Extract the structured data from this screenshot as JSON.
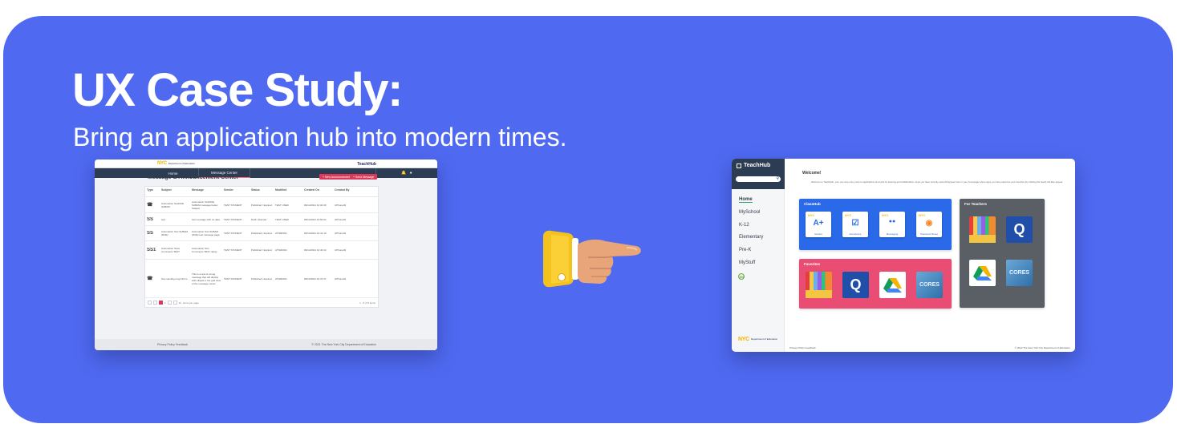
{
  "banner": {
    "title": "UX Case Study:",
    "subtitle": "Bring an application hub into modern times.",
    "background_color": "#4f69f0"
  },
  "old_ui": {
    "nyc_logo": "NYC",
    "nyc_logo_sub": "Department of Education",
    "brand": "TeachHub",
    "nav": [
      "Home",
      "Message Center"
    ],
    "nav_icons": [
      "bell-icon",
      "user-icon"
    ],
    "heading": "Message & Announcement Center",
    "buttons": [
      "+ New Announcement",
      "+ Send Message"
    ],
    "columns": [
      "Type",
      "Subject",
      "Message",
      "Sender",
      "Status",
      "Modified",
      "Created On",
      "Created By"
    ],
    "rows": [
      {
        "type": "☎",
        "subject": "Automation TestDOE SUBAM",
        "message": "Automation TestDOE SUBAM message below Subject",
        "sender": "TEST STUDENT",
        "status": "Published / Expired",
        "modified": "TEST USER",
        "created": "09/14/2021 10:34:09",
        "by": "UPhone02"
      },
      {
        "type": "SS",
        "subject": "test",
        "message": "test message with no data",
        "sender": "TEST STUDENT",
        "status": "Draft / Expired",
        "modified": "TEST USER",
        "created": "09/14/2021 10:50:04",
        "by": "UPhone02"
      },
      {
        "type": "SS",
        "subject": "Automation Test SUBAM (DOE)",
        "message": "Automation Test SUBAM (DOE) test message page",
        "sender": "TEST STUDENT",
        "status": "Published / Expired",
        "modified": "ATSM2021",
        "created": "09/14/2021 10:41:10",
        "by": "UPhone02"
      },
      {
        "type": "SS1",
        "subject": "Automation Tests Comments TEST",
        "message": "Automation Test Comments TEST rating",
        "sender": "TEST STUDENT",
        "status": "Published / Expired",
        "modified": "ATSM2021",
        "created": "09/14/2021 10:43:44",
        "by": "UPhone02"
      },
      {
        "type": "☎",
        "subject": "Test sending long bird to",
        "message": "This is a test of a long message that will display with ellipsis in the grid view of the message center",
        "sender": "TEST STUDENT",
        "status": "Published / Expired",
        "modified": "ATSM2021",
        "created": "09/14/2021 10:47:27",
        "by": "UPhone02"
      }
    ],
    "pager": {
      "page": "1",
      "per_page": "10",
      "per_page_label": "items per page",
      "summary": "1 - 5 of 5 items"
    },
    "footer": {
      "links": "Privacy Policy   Feedback",
      "copyright": "© 2021 The New York City Department of Education"
    }
  },
  "new_ui": {
    "brand": "TeachHub",
    "sidebar": [
      "Home",
      "MySchool",
      "K-12",
      "Elementary",
      "Pre-K",
      "MyStuff"
    ],
    "sidebar_badge": "JM",
    "nyc_logo": "NYC",
    "nyc_logo_sub": "Department of Education",
    "welcome": "Welcome!",
    "welcome_text": "Welcome to TeachHub, your one stop entry point to applications and tools for learning and collaboration. Apps you have recently used will appear here in your homepage where apps you have saved as your favorites (by clicking the heart) will also appear.",
    "classhub": {
      "title": "ClassHub",
      "tiles": [
        {
          "nyc": "NYC",
          "glyph": "A+",
          "label": "Grades"
        },
        {
          "nyc": "NYC",
          "glyph": "☑",
          "label": "Attendance"
        },
        {
          "nyc": "NYC",
          "glyph": "●●",
          "label": "Messaging"
        },
        {
          "nyc": "NYC",
          "glyph": "◉",
          "label": "Password Reset"
        }
      ]
    },
    "favorites": {
      "title": "Favorites"
    },
    "teachers": {
      "title": "For Teachers"
    },
    "q_label": "Q",
    "cores_label": "CORES",
    "footer": {
      "links": "Privacy Policy   Feedback",
      "copyright": "© 2022 The New York City Department of Education"
    }
  }
}
